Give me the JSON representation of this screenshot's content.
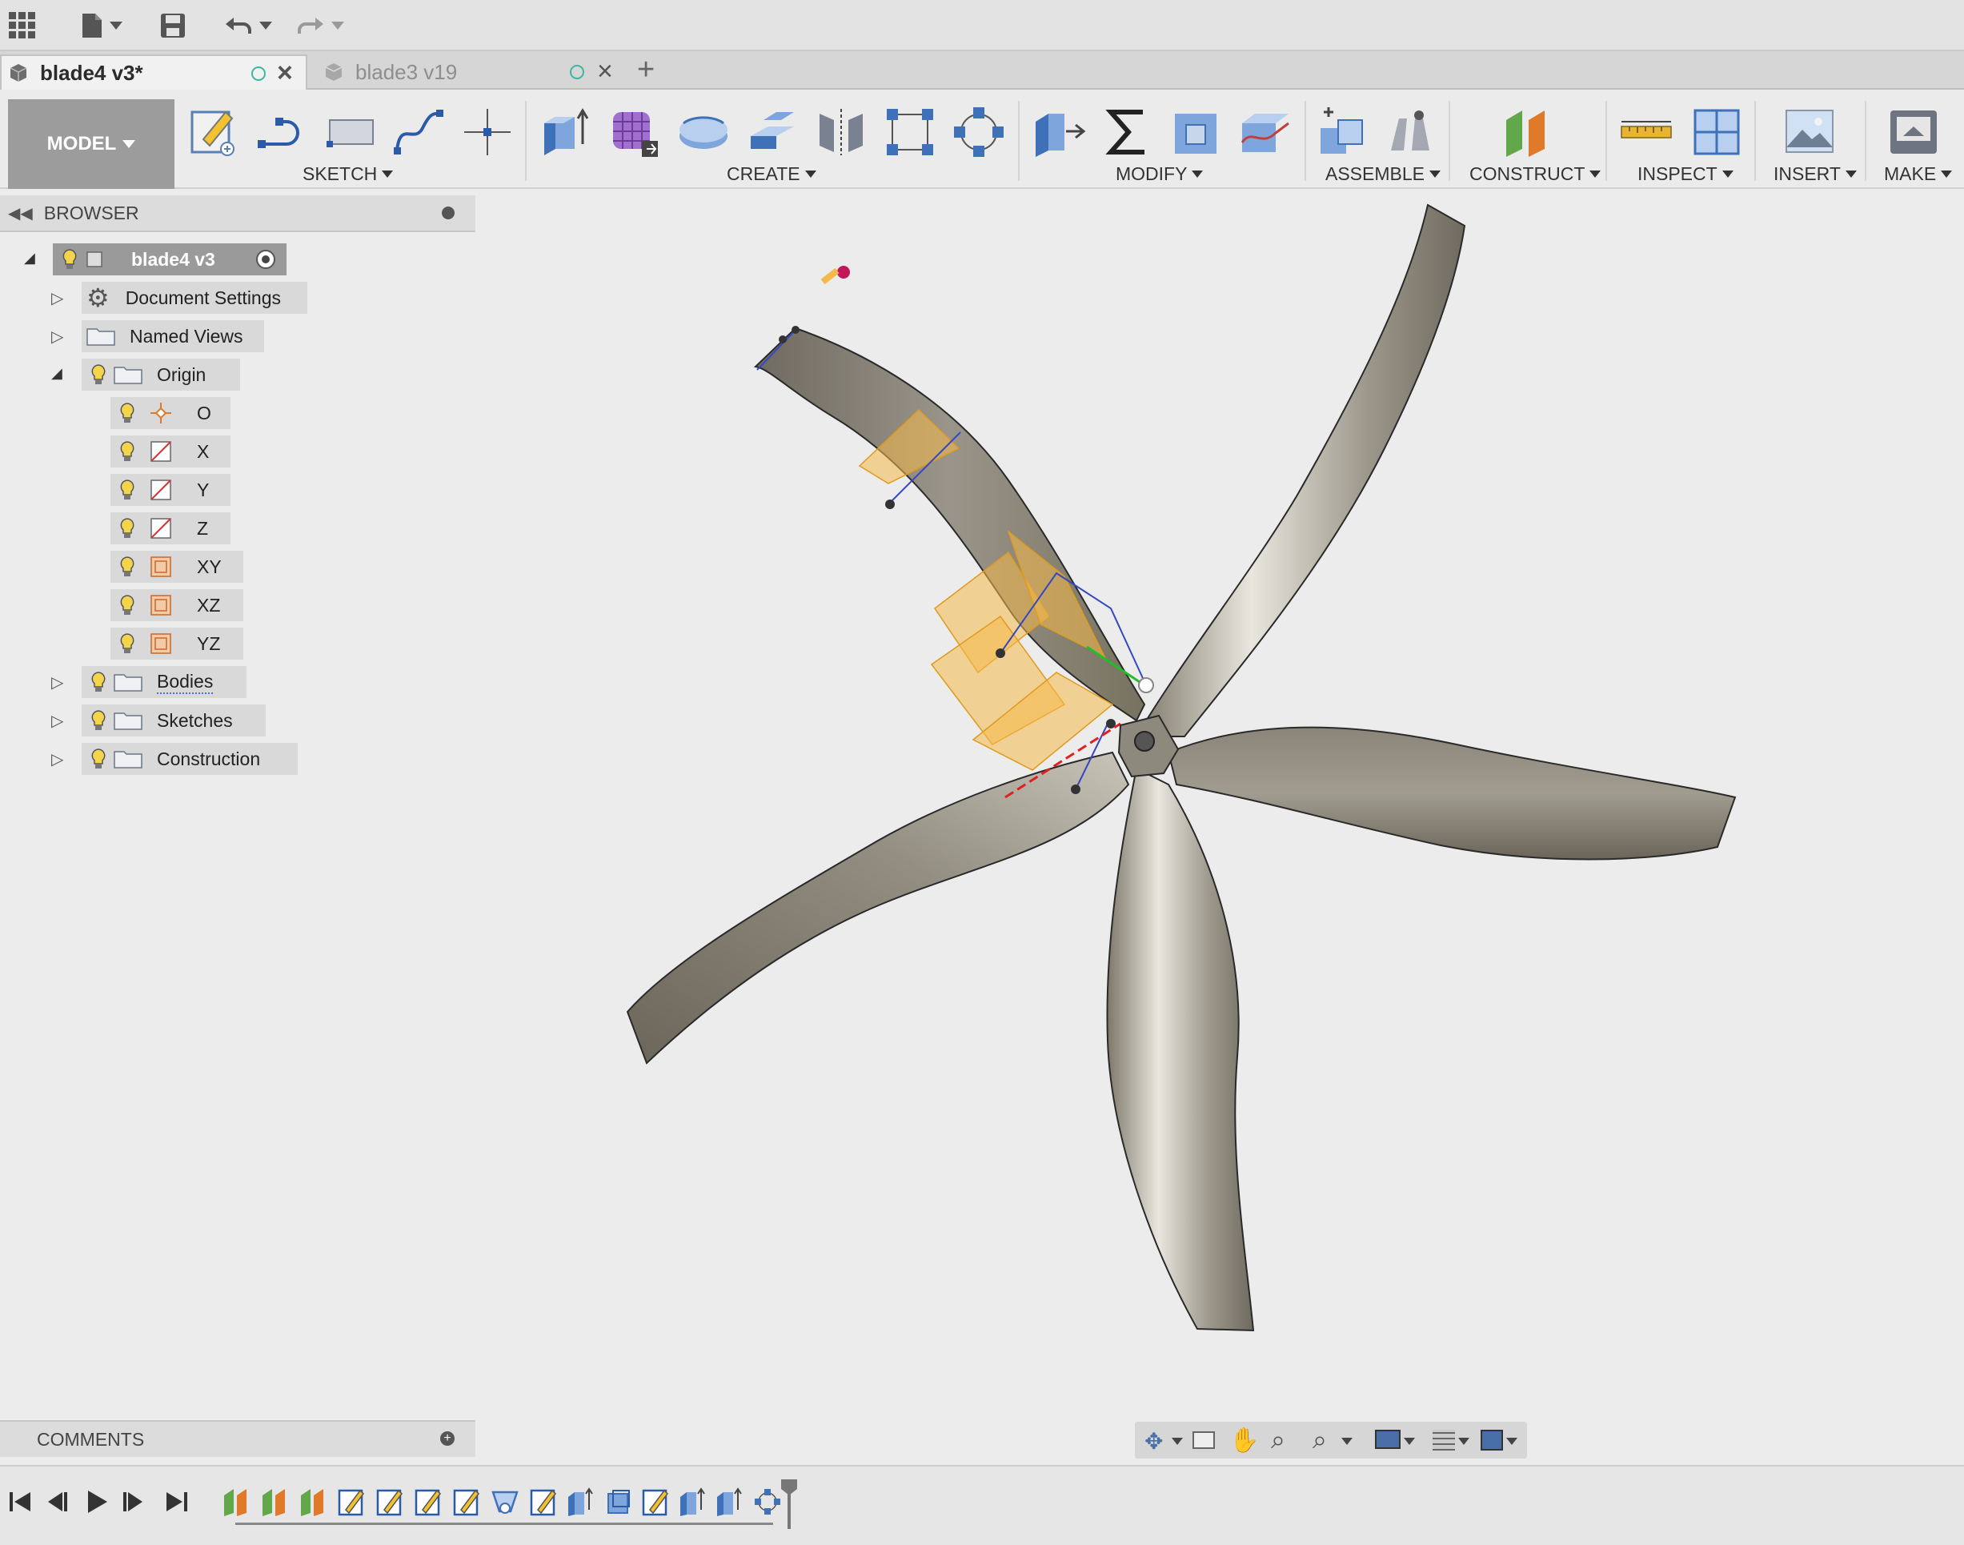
{
  "tabs": [
    {
      "label": "blade4 v3*",
      "active": true
    },
    {
      "label": "blade3 v19",
      "active": false
    }
  ],
  "toolbar": {
    "workspace": "MODEL",
    "groups": {
      "sketch": "SKETCH",
      "create": "CREATE",
      "modify": "MODIFY",
      "assemble": "ASSEMBLE",
      "construct": "CONSTRUCT",
      "inspect": "INSPECT",
      "insert": "INSERT",
      "make": "MAKE"
    }
  },
  "browser": {
    "title": "BROWSER",
    "root": "blade4 v3",
    "items": {
      "document_settings": "Document Settings",
      "named_views": "Named Views",
      "origin": "Origin",
      "origin_o": "O",
      "origin_x": "X",
      "origin_y": "Y",
      "origin_z": "Z",
      "origin_xy": "XY",
      "origin_xz": "XZ",
      "origin_yz": "YZ",
      "bodies": "Bodies",
      "sketches": "Sketches",
      "construction": "Construction"
    }
  },
  "comments": {
    "title": "COMMENTS"
  },
  "icons": {
    "apps": "grid-icon",
    "file": "file-icon",
    "save": "save-icon",
    "undo": "undo-icon",
    "redo": "redo-icon",
    "bulb": "lightbulb-icon",
    "folder": "folder-icon",
    "gear": "gear-icon"
  },
  "colors": {
    "accent": "#3bb89e",
    "blade": "#8a8578",
    "construction_plane": "#f5b94a",
    "model_button": "#9c9c9c"
  }
}
